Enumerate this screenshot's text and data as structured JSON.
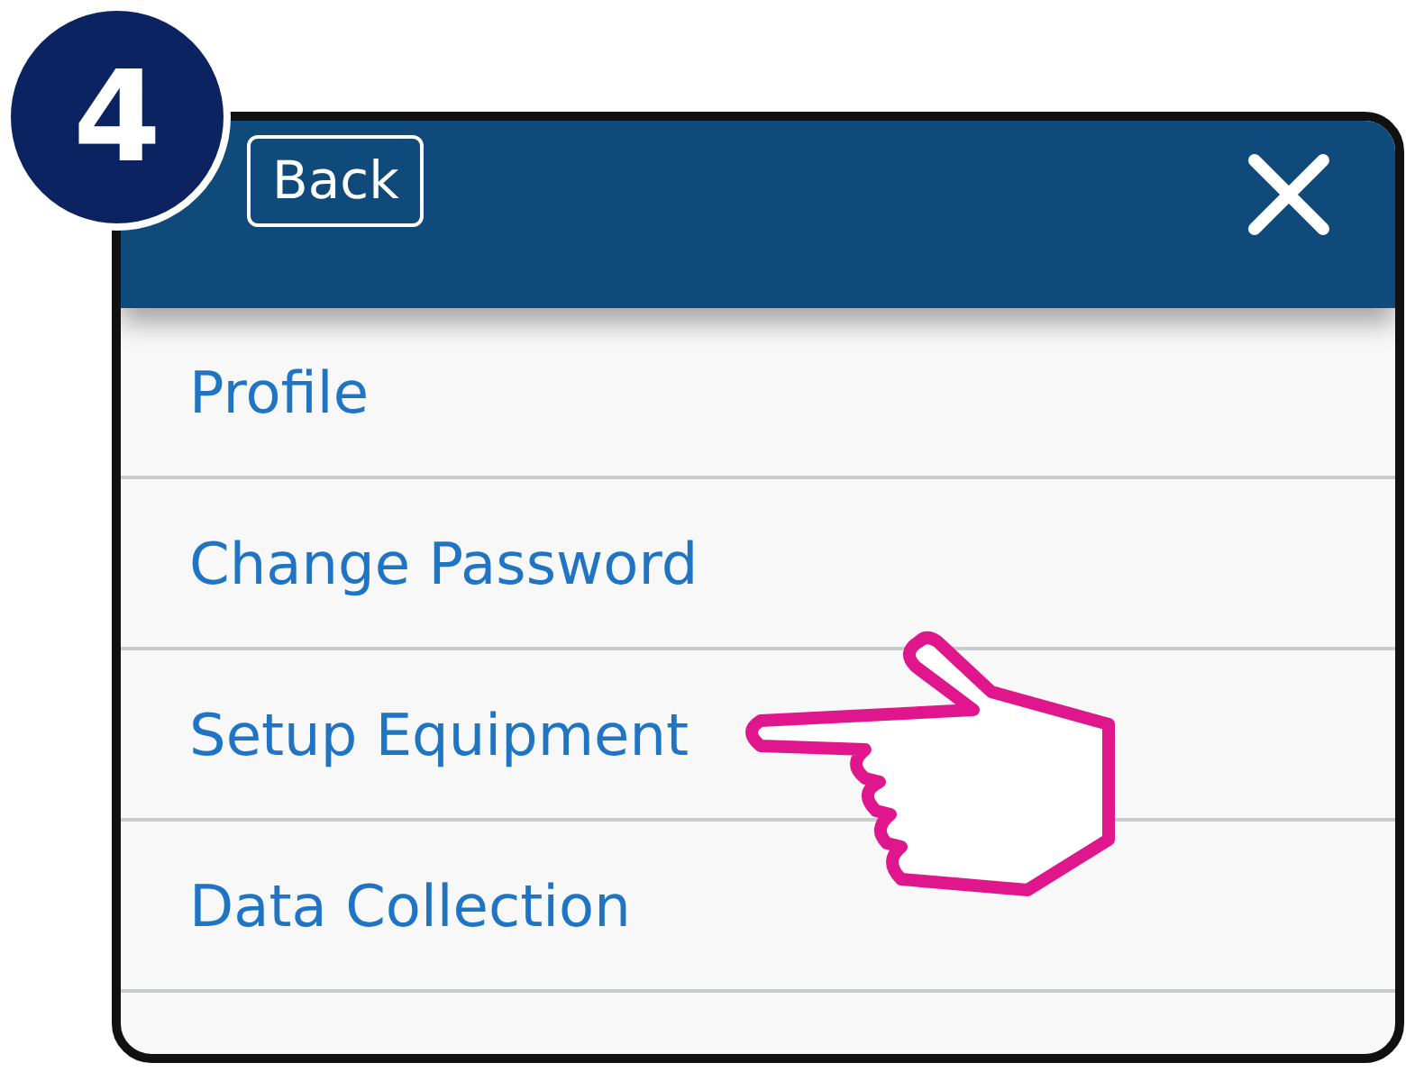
{
  "step_badge": {
    "number": "4"
  },
  "header": {
    "back_button": "Back"
  },
  "menu": {
    "items": [
      {
        "label": "Profile"
      },
      {
        "label": "Change Password"
      },
      {
        "label": "Setup Equipment"
      },
      {
        "label": "Data Collection"
      }
    ]
  }
}
